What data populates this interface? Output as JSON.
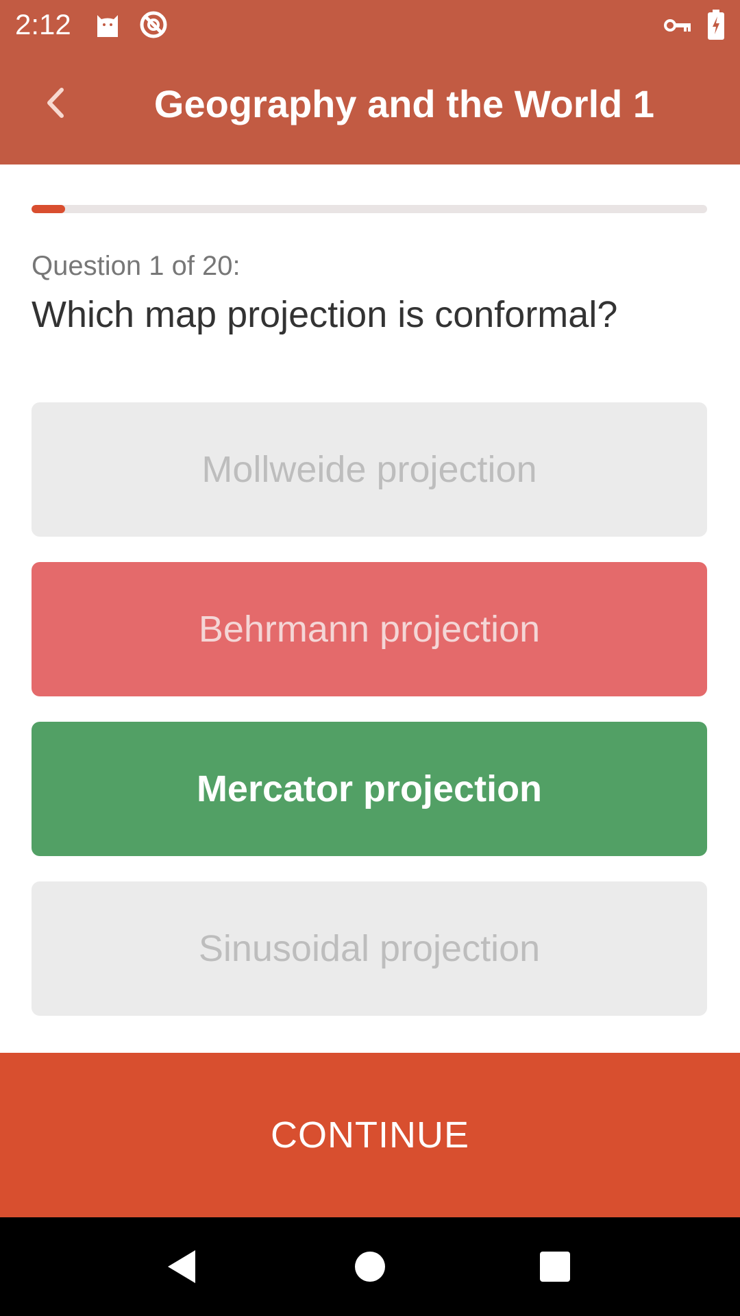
{
  "status_bar": {
    "time": "2:12",
    "icons": [
      "cat-notification-icon",
      "do-not-disturb-icon",
      "vpn-key-icon",
      "battery-charging-icon"
    ]
  },
  "app_bar": {
    "back_icon": "chevron-left-icon",
    "title": "Geography and the World 1"
  },
  "progress": {
    "value": 0.05
  },
  "question": {
    "label": "Question 1 of 20:",
    "text": "Which map projection is conformal?"
  },
  "answers": [
    {
      "label": "Mollweide projection",
      "state": "neutral"
    },
    {
      "label": "Behrmann projection",
      "state": "wrong"
    },
    {
      "label": "Mercator projection",
      "state": "correct"
    },
    {
      "label": "Sinusoidal projection",
      "state": "neutral"
    }
  ],
  "continue_label": "CONTINUE",
  "nav_bar": {
    "icons": [
      "back-triangle-icon",
      "home-circle-icon",
      "recents-square-icon"
    ]
  },
  "colors": {
    "primary": "#c25b43",
    "accent": "#d84f2f",
    "correct": "#52a065",
    "wrong": "#e46a6b",
    "neutral": "#ebebeb"
  }
}
